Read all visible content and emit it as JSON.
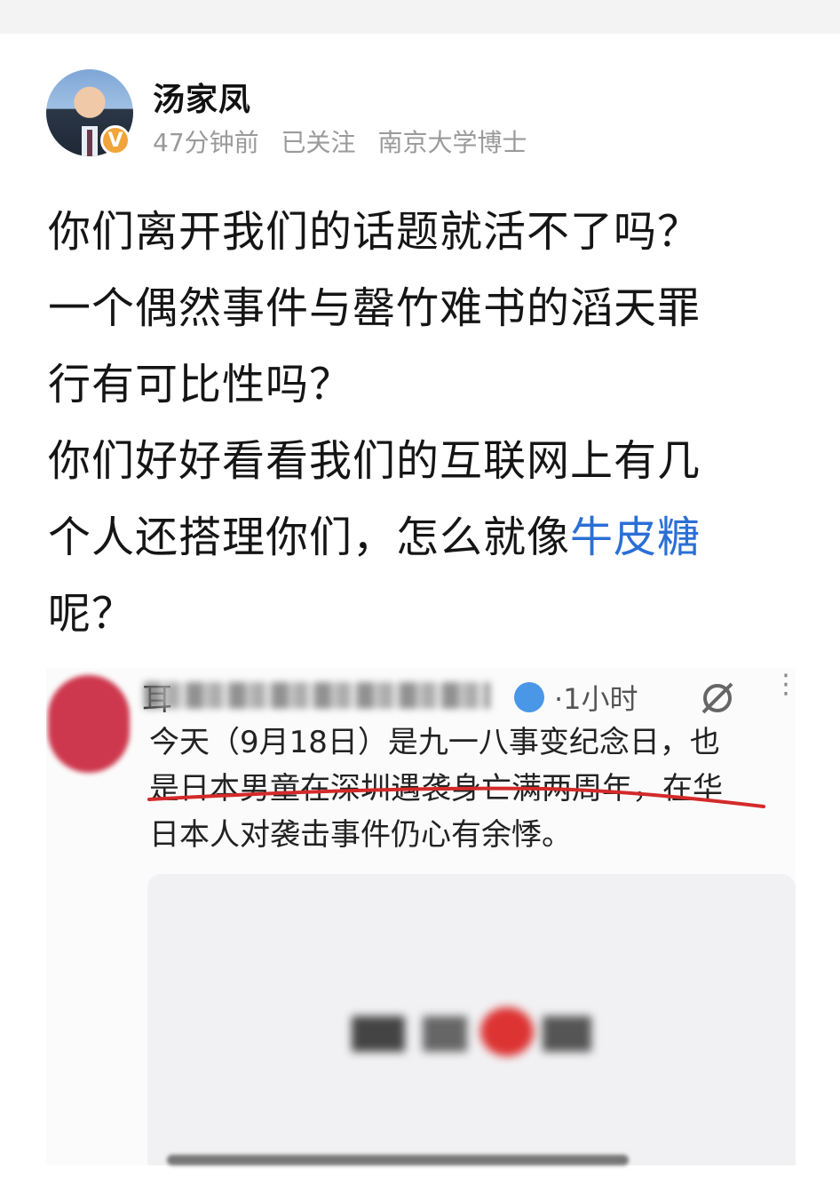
{
  "post": {
    "author": "汤家凤",
    "verified_badge": "V",
    "time": "47分钟前",
    "follow_status": "已关注",
    "author_title": "南京大学博士",
    "lines": [
      "你们离开我们的话题就活不了吗？",
      "一个偶然事件与罄竹难书的滔天罪",
      "行有可比性吗？",
      "你们好好看看我们的互联网上有几",
      "个人还搭理你们，怎么就像",
      "呢？"
    ],
    "link_text": "牛皮糖"
  },
  "screenshot": {
    "name_initial": "耳",
    "time": "·1小时",
    "text_lines": [
      "今天（9月18日）是九一八事变纪念日，也",
      "是日本男童在深圳遇袭身亡满两周年，在华",
      "日本人对袭击事件仍心有余悸。"
    ]
  },
  "colors": {
    "link": "#2b6fd6",
    "badge": "#f1a43a",
    "verified": "#4a97e8",
    "annotation": "#d42a2a"
  },
  "icons": [
    "verified-badge-icon",
    "share-icon",
    "more-vertical-icon"
  ]
}
